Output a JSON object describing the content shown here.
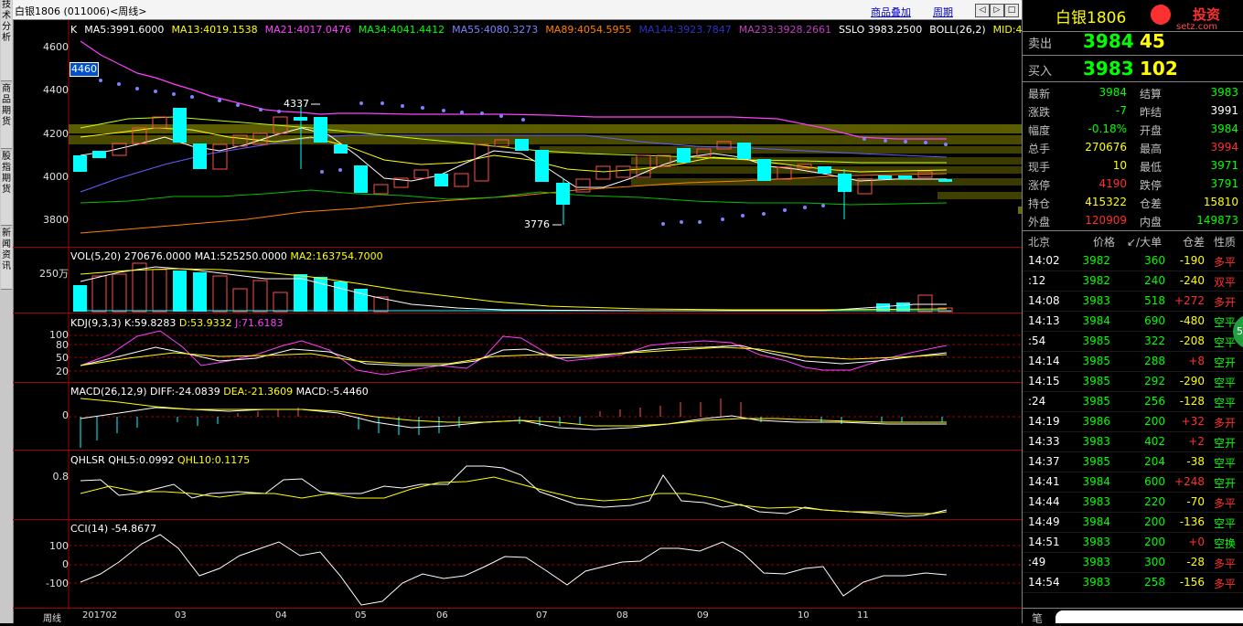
{
  "sidebar": {
    "tabs": [
      "技术分析",
      "商品期货",
      "股指期货",
      "新闻资讯"
    ]
  },
  "titlebar": {
    "title": "白银1806 (011006)<周线>",
    "link1": "商品叠加",
    "link2": "周期"
  },
  "kline": {
    "label": "K",
    "ma": [
      {
        "text": "MA5:3991.6000",
        "color": "#ffffff"
      },
      {
        "text": "MA13:4019.1538",
        "color": "#ffff00"
      },
      {
        "text": "MA21:4017.0476",
        "color": "#ff40ff"
      },
      {
        "text": "MA34:4041.4412",
        "color": "#00ff00"
      },
      {
        "text": "MA55:4080.3273",
        "color": "#8080ff"
      },
      {
        "text": "MA89:4054.5955",
        "color": "#ff8000"
      },
      {
        "text": "MA144:3923.7847",
        "color": "#3030c0"
      },
      {
        "text": "MA233:3928.2661",
        "color": "#c040c0"
      },
      {
        "text": "SSLO 3983.2500",
        "color": "#ffffff"
      },
      {
        "text": "BOLL(26,2)",
        "color": "#ffffff"
      },
      {
        "text": "MID:4028",
        "color": "#ffff00"
      }
    ],
    "yticks": [
      "4600",
      "4400",
      "4200",
      "4000",
      "3800"
    ],
    "cursor_label": "4460",
    "high_label": "4337",
    "low_label": "3776"
  },
  "vol": {
    "title": "VOL(5,20)",
    "v1": "270676.0000",
    "v2": "MA1:525250.0000",
    "v3": "MA2:163754.7000",
    "ytick": "250万"
  },
  "kdj": {
    "title": "KDJ(9,3,3)",
    "k": "K:59.8283",
    "d": "D:53.9332",
    "j": "J:71.6183",
    "yticks": [
      "100",
      "80",
      "50",
      "20"
    ]
  },
  "macd": {
    "title": "MACD(26,12,9)",
    "diff": "DIFF:-24.0839",
    "dea": "DEA:-21.3609",
    "macd": "MACD:-5.4460",
    "ytick": "0"
  },
  "qhlsr": {
    "title": "QHLSR",
    "q5": "QHL5:0.0992",
    "q10": "QHL10:0.1175",
    "ytick": "0.8"
  },
  "cci": {
    "title": "CCI(14)",
    "value": "-54.8677",
    "yticks": [
      "100",
      "0",
      "-100"
    ]
  },
  "xaxis": {
    "label": "周线",
    "ticks": [
      "201702",
      "03",
      "04",
      "05",
      "06",
      "07",
      "08",
      "09",
      "10",
      "11"
    ]
  },
  "quote": {
    "name": "白银1806",
    "logo": "投资",
    "logo_sub": "setz.com",
    "sell_label": "卖出",
    "sell_price": "3984",
    "sell_vol": "45",
    "buy_label": "买入",
    "buy_price": "3983",
    "buy_vol": "102",
    "stats": [
      [
        "最新",
        "3984",
        "结算",
        "3983"
      ],
      [
        "涨跌",
        "-7",
        "昨结",
        "3991"
      ],
      [
        "幅度",
        "-0.18%",
        "开盘",
        "3984"
      ],
      [
        "总手",
        "270676",
        "最高",
        "3994"
      ],
      [
        "现手",
        "10",
        "最低",
        "3971"
      ],
      [
        "涨停",
        "4190",
        "跌停",
        "3791"
      ],
      [
        "持仓",
        "415322",
        "仓差",
        "15810"
      ],
      [
        "外盘",
        "120909",
        "内盘",
        "149873"
      ]
    ],
    "stat_colors": [
      [
        "#00ff00",
        "#00ff00"
      ],
      [
        "#00ff00",
        "#ffffff"
      ],
      [
        "#00ff00",
        "#00ff00"
      ],
      [
        "#ffff00",
        "#ff3030"
      ],
      [
        "#ffff00",
        "#00ff00"
      ],
      [
        "#ff3030",
        "#00ff00"
      ],
      [
        "#ffff00",
        "#ffff00"
      ],
      [
        "#ff3030",
        "#00ff00"
      ]
    ],
    "tick_header": [
      "北京",
      "价格",
      "↙/大单",
      "仓差",
      "性质"
    ],
    "ticks": [
      [
        "14:02",
        "3982",
        "360",
        "-190",
        "多平"
      ],
      [
        ":12",
        "3982",
        "240",
        "-240",
        "双平"
      ],
      [
        "14:08",
        "3983",
        "518",
        "+272",
        "多开"
      ],
      [
        "14:13",
        "3984",
        "690",
        "-480",
        "空平"
      ],
      [
        ":54",
        "3985",
        "322",
        "-208",
        "空平"
      ],
      [
        "14:14",
        "3985",
        "288",
        "+8",
        "空开"
      ],
      [
        "14:15",
        "3985",
        "292",
        "-290",
        "空平"
      ],
      [
        ":24",
        "3985",
        "256",
        "-128",
        "空平"
      ],
      [
        "14:19",
        "3986",
        "200",
        "+32",
        "多开"
      ],
      [
        "14:33",
        "3983",
        "402",
        "+2",
        "空开"
      ],
      [
        "14:37",
        "3985",
        "204",
        "-38",
        "空平"
      ],
      [
        "14:41",
        "3984",
        "600",
        "+248",
        "空开"
      ],
      [
        "14:44",
        "3983",
        "220",
        "-70",
        "多平"
      ],
      [
        "14:49",
        "3984",
        "200",
        "-136",
        "空平"
      ],
      [
        "14:51",
        "3983",
        "200",
        "+0",
        "空换"
      ],
      [
        ":49",
        "3983",
        "300",
        "-28",
        "多平"
      ],
      [
        "14:54",
        "3983",
        "258",
        "-156",
        "多平"
      ]
    ],
    "bottom_label": "笔",
    "badge": "53"
  }
}
